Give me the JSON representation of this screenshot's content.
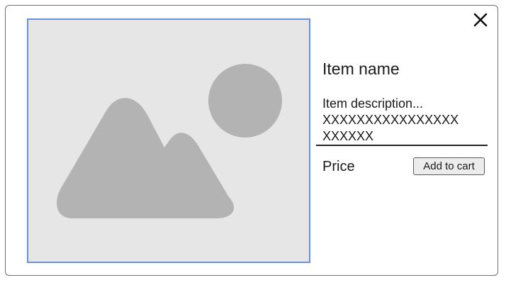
{
  "modal": {
    "close_icon": "close-icon",
    "image": {
      "icon": "image-placeholder-icon",
      "background_color": "#e6e6e6",
      "border_color": "#6c8fdc",
      "shape_color": "#b3b3b3"
    },
    "item_name": "Item name",
    "description": {
      "line1": "Item description...",
      "line2": "XXXXXXXXXXXXXXXX",
      "line3": "XXXXXX"
    },
    "price_label": "Price",
    "add_to_cart_label": "Add to cart"
  }
}
